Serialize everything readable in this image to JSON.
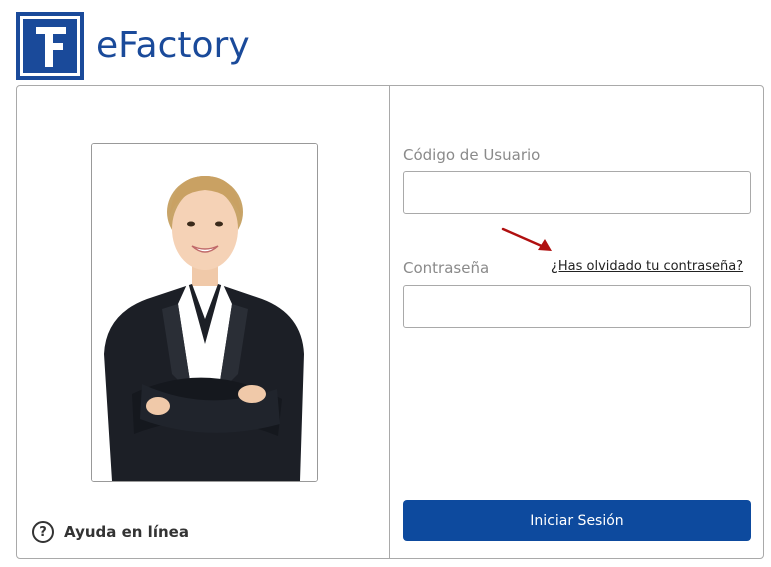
{
  "header": {
    "app_name": "eFactory",
    "logo_icon": "efactory-logo-icon",
    "brand_color": "#1a4a9a"
  },
  "left_panel": {
    "photo_icon": "woman-portrait-photo",
    "help": {
      "icon": "question-circle-icon",
      "icon_glyph": "?",
      "label": "Ayuda en línea"
    }
  },
  "login_form": {
    "username_label": "Código de Usuario",
    "username_value": "",
    "password_label": "Contraseña",
    "password_value": "",
    "forgot_password_link": "¿Has olvidado tu contraseña?",
    "arrow_icon": "red-arrow-icon",
    "arrow_color": "#b01010",
    "submit_label": "Iniciar Sesión",
    "submit_color": "#0d4a9e"
  }
}
